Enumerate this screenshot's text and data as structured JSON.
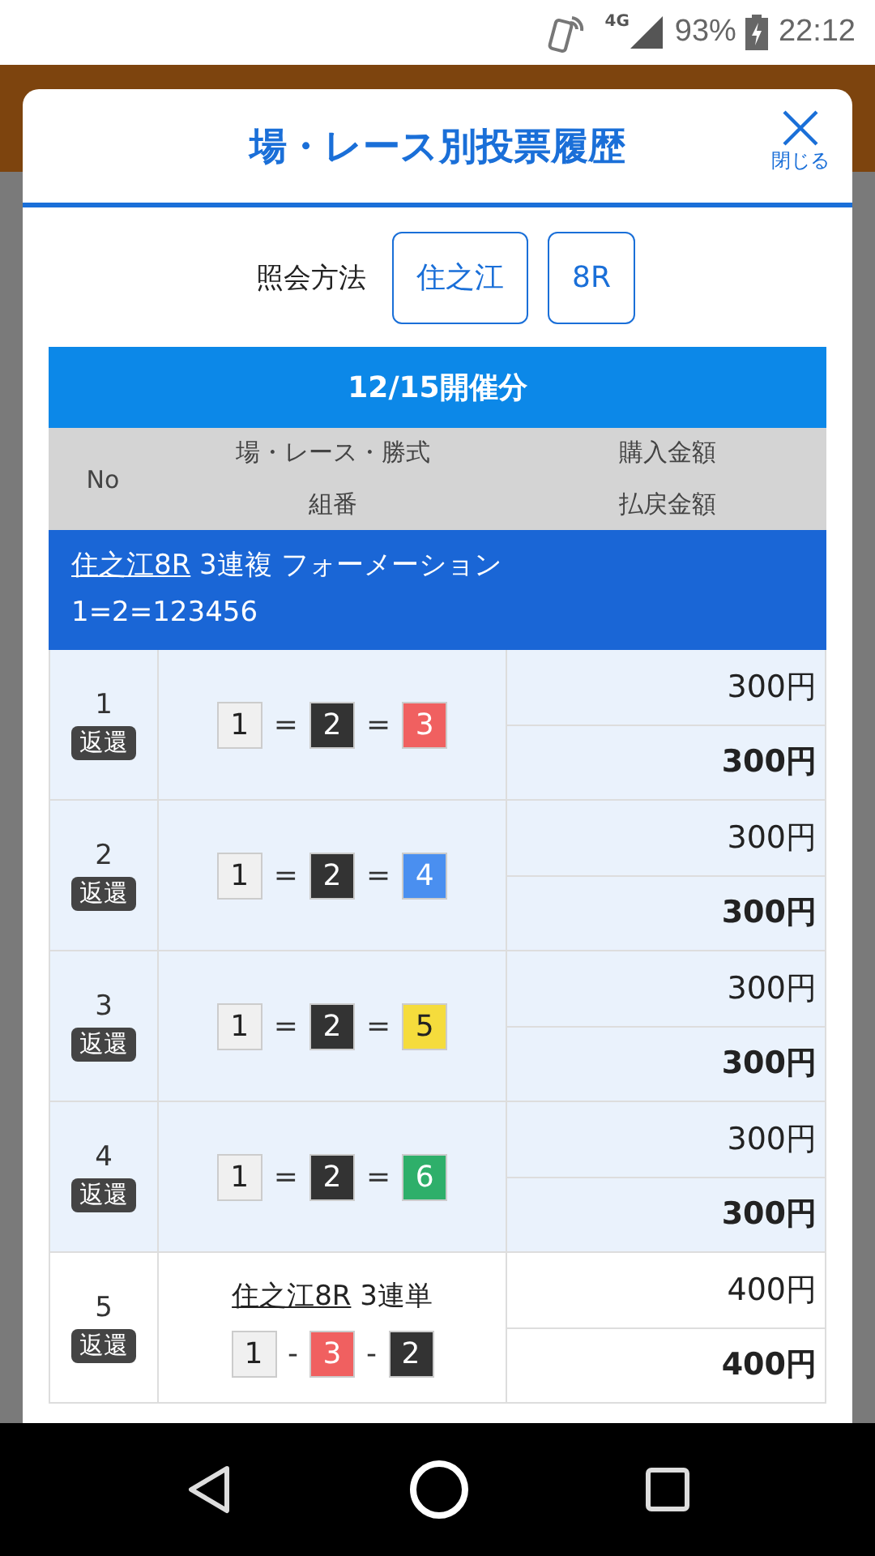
{
  "status_bar": {
    "network": "4G",
    "battery": "93%",
    "time": "22:12"
  },
  "dialog": {
    "title": "場・レース別投票履歴",
    "close_label": "閉じる",
    "query_label": "照会方法",
    "query_buttons": [
      "住之江",
      "8R"
    ]
  },
  "table": {
    "date_header": "12/15開催分",
    "columns": {
      "no": "No",
      "race": "場・レース・勝式",
      "combo": "組番",
      "purchase": "購入金額",
      "payout": "払戻金額"
    },
    "group": {
      "link": "住之江8R",
      "text": " 3連複 フォーメーション",
      "combo": "1=2=123456"
    },
    "rows": [
      {
        "kind": "sub",
        "no": "1",
        "badge": "返還",
        "boats": [
          {
            "number": "1",
            "color": "#f0f0f0"
          },
          {
            "number": "2",
            "color": "#333333"
          },
          {
            "number": "3",
            "color": "#f06060"
          }
        ],
        "separator": "=",
        "purchase": "300円",
        "payout": "300円"
      },
      {
        "kind": "sub",
        "no": "2",
        "badge": "返還",
        "boats": [
          {
            "number": "1",
            "color": "#f0f0f0"
          },
          {
            "number": "2",
            "color": "#333333"
          },
          {
            "number": "4",
            "color": "#4a8ff0"
          }
        ],
        "separator": "=",
        "purchase": "300円",
        "payout": "300円"
      },
      {
        "kind": "sub",
        "no": "3",
        "badge": "返還",
        "boats": [
          {
            "number": "1",
            "color": "#f0f0f0"
          },
          {
            "number": "2",
            "color": "#333333"
          },
          {
            "number": "5",
            "color": "#f5dc3c"
          }
        ],
        "separator": "=",
        "purchase": "300円",
        "payout": "300円"
      },
      {
        "kind": "sub",
        "no": "4",
        "badge": "返還",
        "boats": [
          {
            "number": "1",
            "color": "#f0f0f0"
          },
          {
            "number": "2",
            "color": "#333333"
          },
          {
            "number": "6",
            "color": "#2eaf6a"
          }
        ],
        "separator": "=",
        "purchase": "300円",
        "payout": "300円"
      },
      {
        "kind": "ticket",
        "no": "5",
        "badge": "返還",
        "title_link": "住之江8R",
        "title_text": " 3連単",
        "boats": [
          {
            "number": "1",
            "color": "#f0f0f0"
          },
          {
            "number": "3",
            "color": "#f06060"
          },
          {
            "number": "2",
            "color": "#333333"
          }
        ],
        "separator": "-",
        "purchase": "400円",
        "payout": "400円"
      }
    ]
  }
}
